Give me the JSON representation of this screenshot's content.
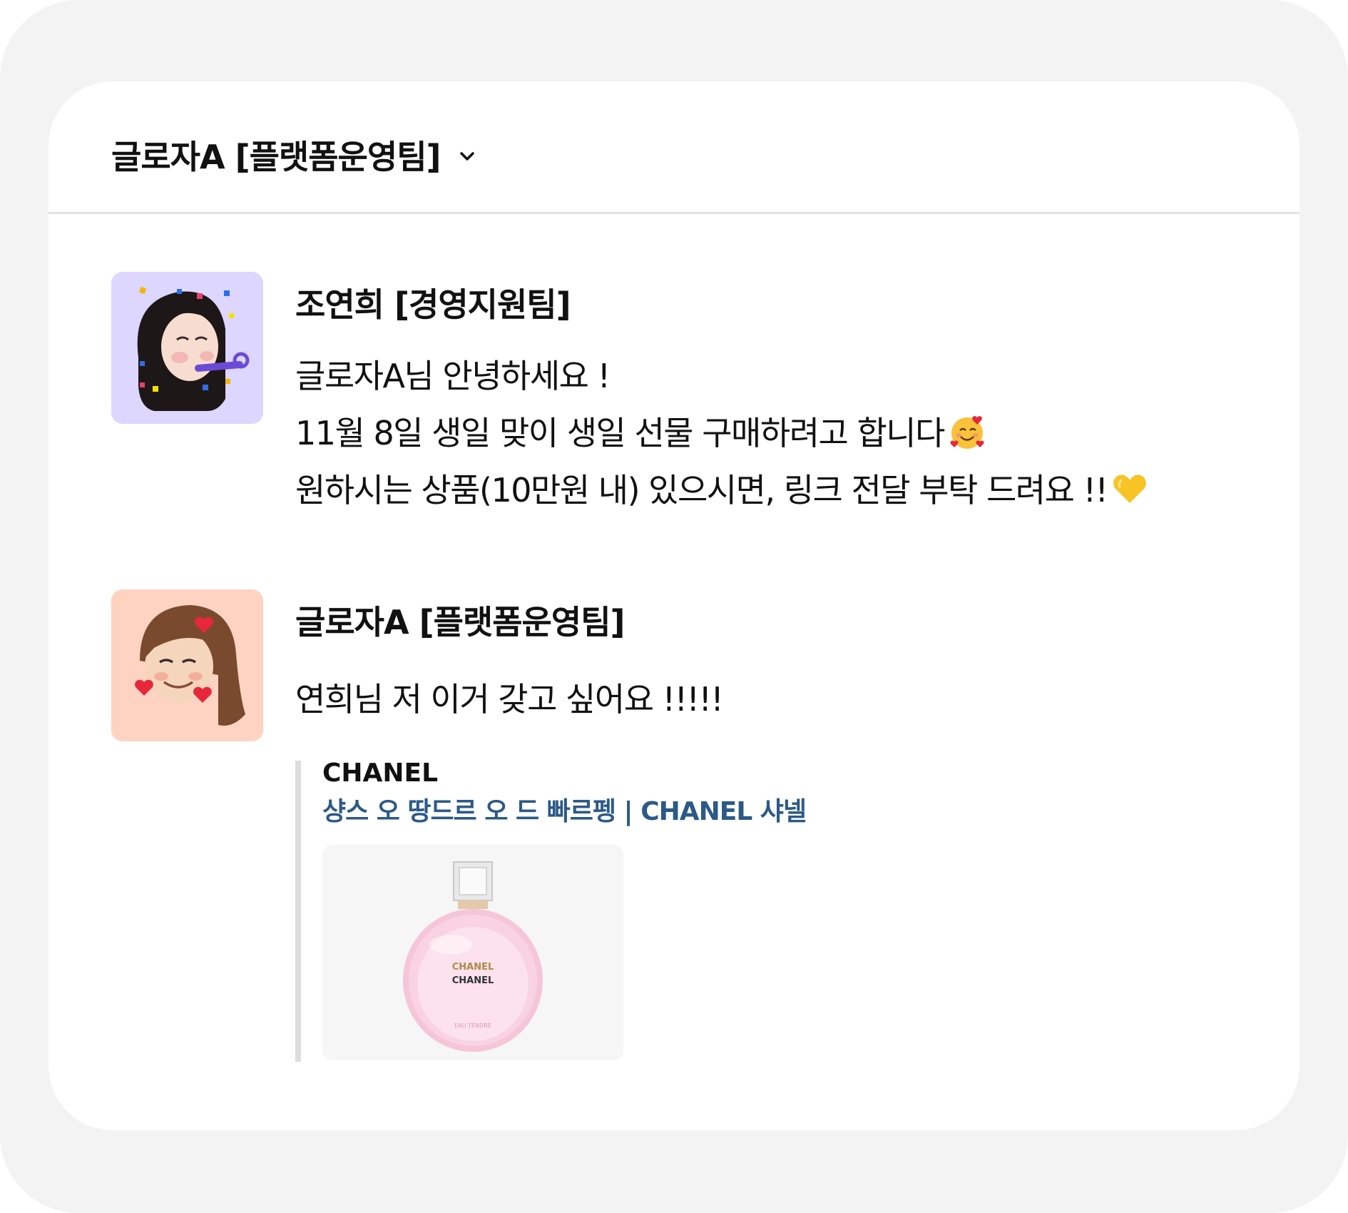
{
  "header": {
    "title": "글로자A [플랫폼운영팀]",
    "dropdown_icon": "chevron-down-icon"
  },
  "messages": [
    {
      "sender": "조연희 [경영지원팀]",
      "avatar_icon": "memoji-party-avatar",
      "lines": [
        "글로자A님 안녕하세요 !",
        "11월 8일 생일 맞이 생일 선물 구매하려고 합니다",
        "원하시는 상품(10만원 내) 있으시면, 링크 전달 부탁 드려요 !!"
      ],
      "line_emojis": [
        "",
        "smiling-face-with-hearts-emoji",
        "yellow-heart-emoji"
      ]
    },
    {
      "sender": "글로자A [플랫폼운영팀]",
      "avatar_icon": "memoji-hearts-avatar",
      "lines": [
        "연희님 저 이거 갖고 싶어요 !!!!!"
      ],
      "link_preview": {
        "site": "CHANEL",
        "title": "샹스 오 땅드르 오 드 빠르펭 | CHANEL 샤넬",
        "image": {
          "label_top": "CHANEL",
          "label_bottom": "CHANEL",
          "label_small": "EAU TENDRE"
        }
      }
    }
  ],
  "colors": {
    "frame_bg": "#f3f3f3",
    "card_bg": "#ffffff",
    "link_title": "#2c5a86",
    "avatar1_bg": "#ddd6ff",
    "avatar2_bg": "#ffd3c2"
  }
}
